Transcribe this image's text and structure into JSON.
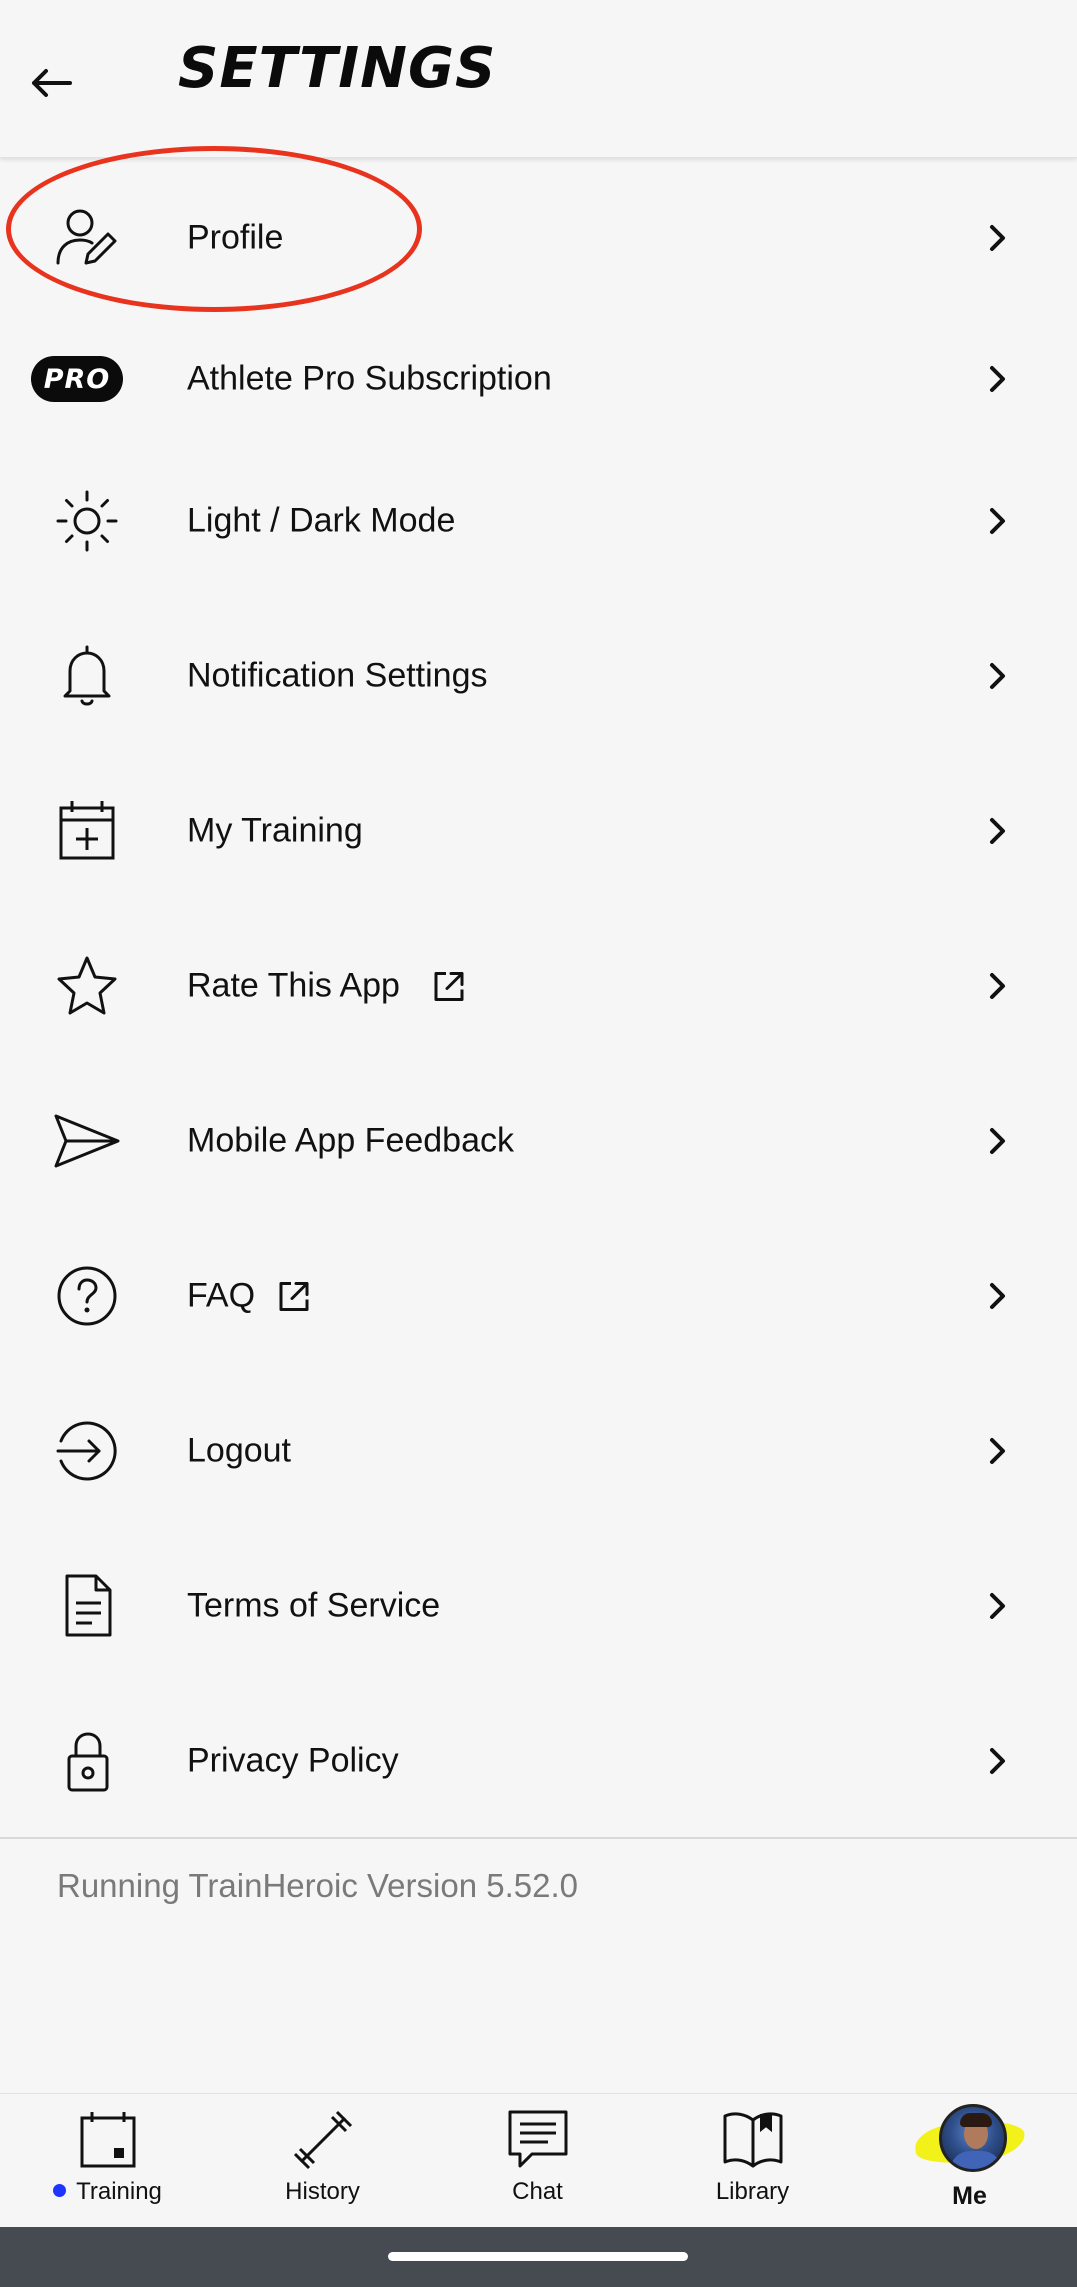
{
  "header": {
    "title": "SETTINGS",
    "back_icon": "arrow-left-icon"
  },
  "menu": {
    "items": [
      {
        "label": "Profile",
        "icon": "user-edit-icon",
        "external": false
      },
      {
        "label": "Athlete Pro Subscription",
        "icon": "pro-badge",
        "badge_text": "PRO",
        "external": false
      },
      {
        "label": "Light / Dark Mode",
        "icon": "sun-icon",
        "external": false
      },
      {
        "label": "Notification Settings",
        "icon": "bell-icon",
        "external": false
      },
      {
        "label": "My Training",
        "icon": "calendar-plus-icon",
        "external": false
      },
      {
        "label": "Rate This App",
        "icon": "star-icon",
        "external": true
      },
      {
        "label": "Mobile App Feedback",
        "icon": "send-icon",
        "external": false
      },
      {
        "label": "FAQ",
        "icon": "help-circle-icon",
        "external": true
      },
      {
        "label": "Logout",
        "icon": "logout-icon",
        "external": false
      },
      {
        "label": "Terms of Service",
        "icon": "document-icon",
        "external": false
      },
      {
        "label": "Privacy Policy",
        "icon": "lock-icon",
        "external": false
      }
    ]
  },
  "annotation": {
    "color": "#e8341e",
    "target": "Profile"
  },
  "footer": {
    "version_text": "Running TrainHeroic Version 5.52.0"
  },
  "bottom_nav": {
    "items": [
      {
        "label": "Training",
        "icon": "calendar-icon",
        "has_dot": true,
        "dot_color": "#1d35ff"
      },
      {
        "label": "History",
        "icon": "barbell-icon"
      },
      {
        "label": "Chat",
        "icon": "chat-icon"
      },
      {
        "label": "Library",
        "icon": "book-icon"
      },
      {
        "label": "Me",
        "icon": "avatar",
        "active": true
      }
    ]
  },
  "colors": {
    "background": "#f6f6f6",
    "text": "#111111",
    "muted": "#7a7a7a",
    "system_bar": "#454b50"
  }
}
